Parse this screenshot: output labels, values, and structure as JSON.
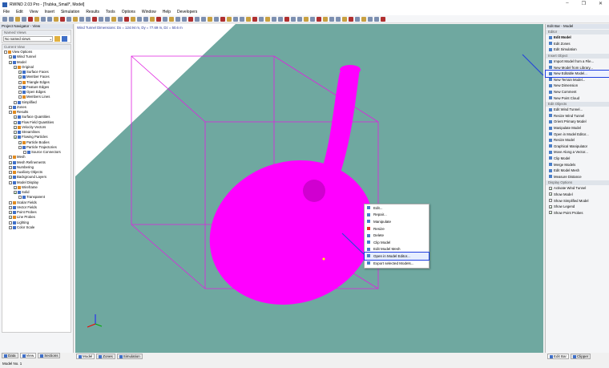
{
  "window": {
    "title": "RWIND 2.03 Pro - [Trubka_Small*, Model]",
    "controls": [
      "–",
      "❐",
      "✕"
    ]
  },
  "menu": [
    "File",
    "Edit",
    "View",
    "Insert",
    "Simulation",
    "Results",
    "Tools",
    "Options",
    "Window",
    "Help",
    "Developers"
  ],
  "navigator": {
    "title": "Project Navigator - View",
    "named_views": {
      "header": "Named Views",
      "value": "No named views"
    },
    "current_view_header": "Current View",
    "tree": [
      {
        "label": "View Options",
        "lvl": 0,
        "cb": ""
      },
      {
        "label": "Wind Tunnel",
        "lvl": 1,
        "cb": "✓"
      },
      {
        "label": "Model",
        "lvl": 1,
        "cb": "✓"
      },
      {
        "label": "Original",
        "lvl": 2,
        "cb": "✓"
      },
      {
        "label": "Surface Faces",
        "lvl": 3,
        "cb": "✓"
      },
      {
        "label": "Member Faces",
        "lvl": 3,
        "cb": "✓"
      },
      {
        "label": "Triangle Edges",
        "lvl": 3,
        "cb": ""
      },
      {
        "label": "Feature Edges",
        "lvl": 3,
        "cb": ""
      },
      {
        "label": "Open Edges",
        "lvl": 3,
        "cb": ""
      },
      {
        "label": "Members Lines",
        "lvl": 3,
        "cb": ""
      },
      {
        "label": "Simplified",
        "lvl": 2,
        "cb": ""
      },
      {
        "label": "Zones",
        "lvl": 1,
        "cb": ""
      },
      {
        "label": "Results",
        "lvl": 1,
        "cb": ""
      },
      {
        "label": "Surface Quantities",
        "lvl": 2,
        "cb": "○"
      },
      {
        "label": "Flow Field Quantities",
        "lvl": 2,
        "cb": "○"
      },
      {
        "label": "Velocity Vectors",
        "lvl": 2,
        "cb": "○"
      },
      {
        "label": "Streamlines",
        "lvl": 2,
        "cb": "○"
      },
      {
        "label": "Flowing Particles",
        "lvl": 2,
        "cb": "●"
      },
      {
        "label": "Particle Bodies",
        "lvl": 3,
        "cb": "✓"
      },
      {
        "label": "Particle Trajectories",
        "lvl": 3,
        "cb": ""
      },
      {
        "label": "Source Connectors",
        "lvl": 4,
        "cb": ""
      },
      {
        "label": "Mesh",
        "lvl": 1,
        "cb": ""
      },
      {
        "label": "Mesh Refinements",
        "lvl": 1,
        "cb": "✓"
      },
      {
        "label": "Numbering",
        "lvl": 1,
        "cb": ""
      },
      {
        "label": "Auxiliary Objects",
        "lvl": 1,
        "cb": ""
      },
      {
        "label": "Background Layers",
        "lvl": 1,
        "cb": "✓"
      },
      {
        "label": "Model Display",
        "lvl": 1,
        "cb": ""
      },
      {
        "label": "Wireframe",
        "lvl": 2,
        "cb": "○"
      },
      {
        "label": "Solid",
        "lvl": 2,
        "cb": "●"
      },
      {
        "label": "Transparent",
        "lvl": 3,
        "cb": ""
      },
      {
        "label": "Scalar Fields",
        "lvl": 1,
        "cb": ""
      },
      {
        "label": "Vector Fields",
        "lvl": 1,
        "cb": ""
      },
      {
        "label": "Point Probes",
        "lvl": 1,
        "cb": "✓"
      },
      {
        "label": "Line Probes",
        "lvl": 1,
        "cb": "✓"
      },
      {
        "label": "Lighting",
        "lvl": 1,
        "cb": ""
      },
      {
        "label": "Color Scale",
        "lvl": 1,
        "cb": ""
      }
    ],
    "tabs": [
      "Data",
      "View",
      "Sections"
    ]
  },
  "viewport": {
    "info": "Wind Tunnel Dimensions: Dx = 124.94 m, Dy = 77.69 m, Dz = 50.6 m",
    "floor_color": "#6fa8a0",
    "model_color": "#ff00ff",
    "tabs": [
      "Model",
      "Zones",
      "Simulation"
    ]
  },
  "context_menu": {
    "items": [
      "Edit...",
      "Repair...",
      "Manipulate",
      "Resize",
      "Delete",
      "Clip Model",
      "Edit Model Mesh",
      "Open in Model Editor...",
      "Export selected Models..."
    ],
    "selected": "Open in Model Editor..."
  },
  "editbar": {
    "title": "Edit Bar - Model",
    "sections": [
      {
        "header": "Editor",
        "items": [
          "Edit Model",
          "Edit Zones",
          "Edit Simulation"
        ]
      },
      {
        "header": "Insert Object",
        "items": [
          "Import Model from a File...",
          "New Model from Library...",
          "New Editable Model...",
          "New Terrain Model...",
          "New Dimension",
          "New Comment",
          "New Point Cloud"
        ]
      },
      {
        "header": "Edit Objects",
        "items": [
          "Edit Wind Tunnel...",
          "Resize Wind Tunnel",
          "Orient Primary Model",
          "Manipulate Model",
          "Open in Model Editor...",
          "Resize Model",
          "Graphical Manipulator",
          "Move Along a Vector...",
          "Clip Model",
          "Merge Models",
          "Edit Model Mesh",
          "Measure Distance"
        ]
      },
      {
        "header": "Display Options",
        "checks": [
          {
            "label": "Activate Wind Tunnel",
            "checked": true
          },
          {
            "label": "Show Model",
            "checked": true
          },
          {
            "label": "Show Simplified Model",
            "checked": false
          },
          {
            "label": "Show Legend",
            "checked": true
          },
          {
            "label": "Show Point Probes",
            "checked": true
          }
        ]
      }
    ],
    "selected": "New Editable Model...",
    "tabs": [
      "Edit Bar",
      "Clipper"
    ]
  },
  "status": "Model No. 1"
}
